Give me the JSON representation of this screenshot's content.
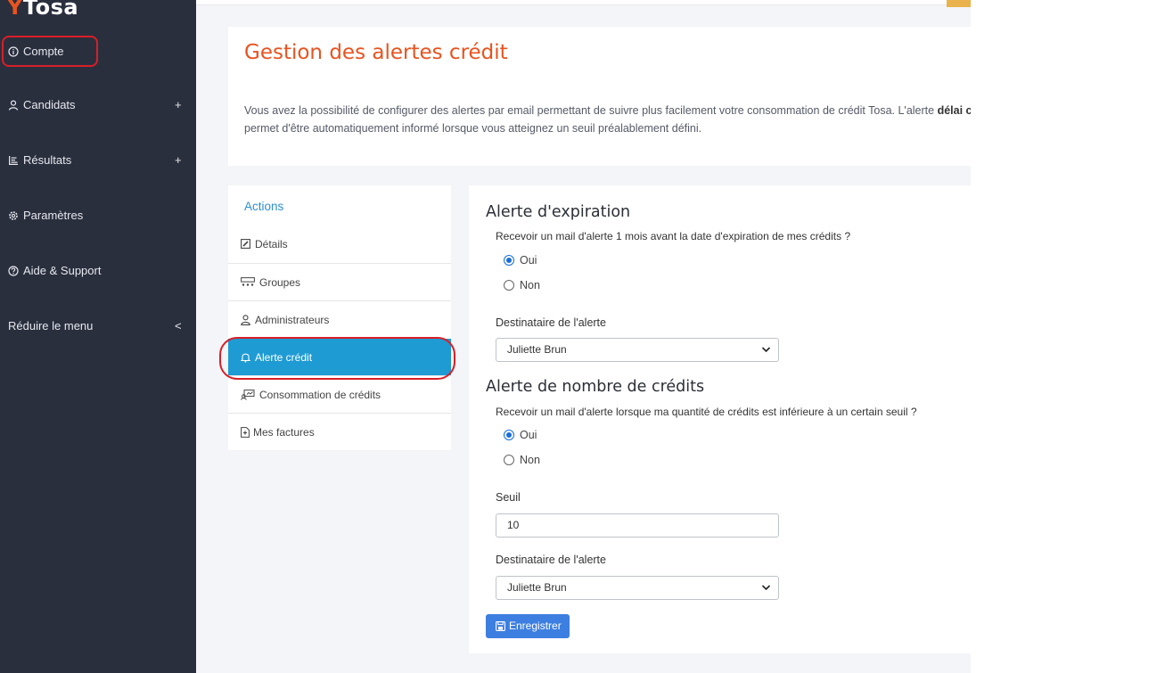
{
  "logo": {
    "text": "Tosa",
    "mark": "Y"
  },
  "sidebar": {
    "items": [
      {
        "label": "Compte",
        "icon": "info-circle-icon"
      },
      {
        "label": "Candidats",
        "icon": "user-icon",
        "expand": "+"
      },
      {
        "label": "Résultats",
        "icon": "list-icon",
        "expand": "+"
      },
      {
        "label": "Paramètres",
        "icon": "gear-icon"
      },
      {
        "label": "Aide & Support",
        "icon": "question-circle-icon"
      }
    ],
    "reduce": {
      "label": "Réduire le menu",
      "chevron": "<"
    }
  },
  "header": {
    "title": "Gestion des alertes crédit",
    "desc_line1": "Vous avez la possibilité de configurer des alertes par email permettant de suivre plus facilement votre consommation de crédit Tosa. L'alerte ",
    "desc_bold": "délai c",
    "desc_line2": "permet d'être automatiquement informé lorsque vous atteignez un seuil préalablement défini."
  },
  "actions": {
    "title": "Actions",
    "items": [
      {
        "label": "Détails",
        "icon": "edit-icon"
      },
      {
        "label": "Groupes",
        "icon": "group-icon"
      },
      {
        "label": "Administrateurs",
        "icon": "admin-icon"
      },
      {
        "label": "Alerte crédit",
        "icon": "bell-icon",
        "active": true
      },
      {
        "label": "Consommation de crédits",
        "icon": "consumption-icon"
      },
      {
        "label": "Mes factures",
        "icon": "invoice-icon"
      }
    ]
  },
  "form": {
    "expiration": {
      "title": "Alerte d'expiration",
      "question": "Recevoir un mail d'alerte 1 mois avant la date d'expiration de mes crédits ?",
      "yes": "Oui",
      "no": "Non",
      "selected": "Oui",
      "recipient_label": "Destinataire de l'alerte",
      "recipient_value": "Juliette Brun"
    },
    "count": {
      "title": "Alerte de nombre de crédits",
      "question": "Recevoir un mail d'alerte lorsque ma quantité de crédits est inférieure à un certain seuil ?",
      "yes": "Oui",
      "no": "Non",
      "selected": "Oui",
      "threshold_label": "Seuil",
      "threshold_value": "10",
      "recipient_label": "Destinataire de l'alerte",
      "recipient_value": "Juliette Brun"
    },
    "save_label": "Enregistrer"
  },
  "colors": {
    "sidebar_bg": "#2a2f3e",
    "accent_orange": "#e8531f",
    "active_blue": "#1f9bd3",
    "button_blue": "#3d7fe0",
    "highlight_red": "#d81f26"
  }
}
